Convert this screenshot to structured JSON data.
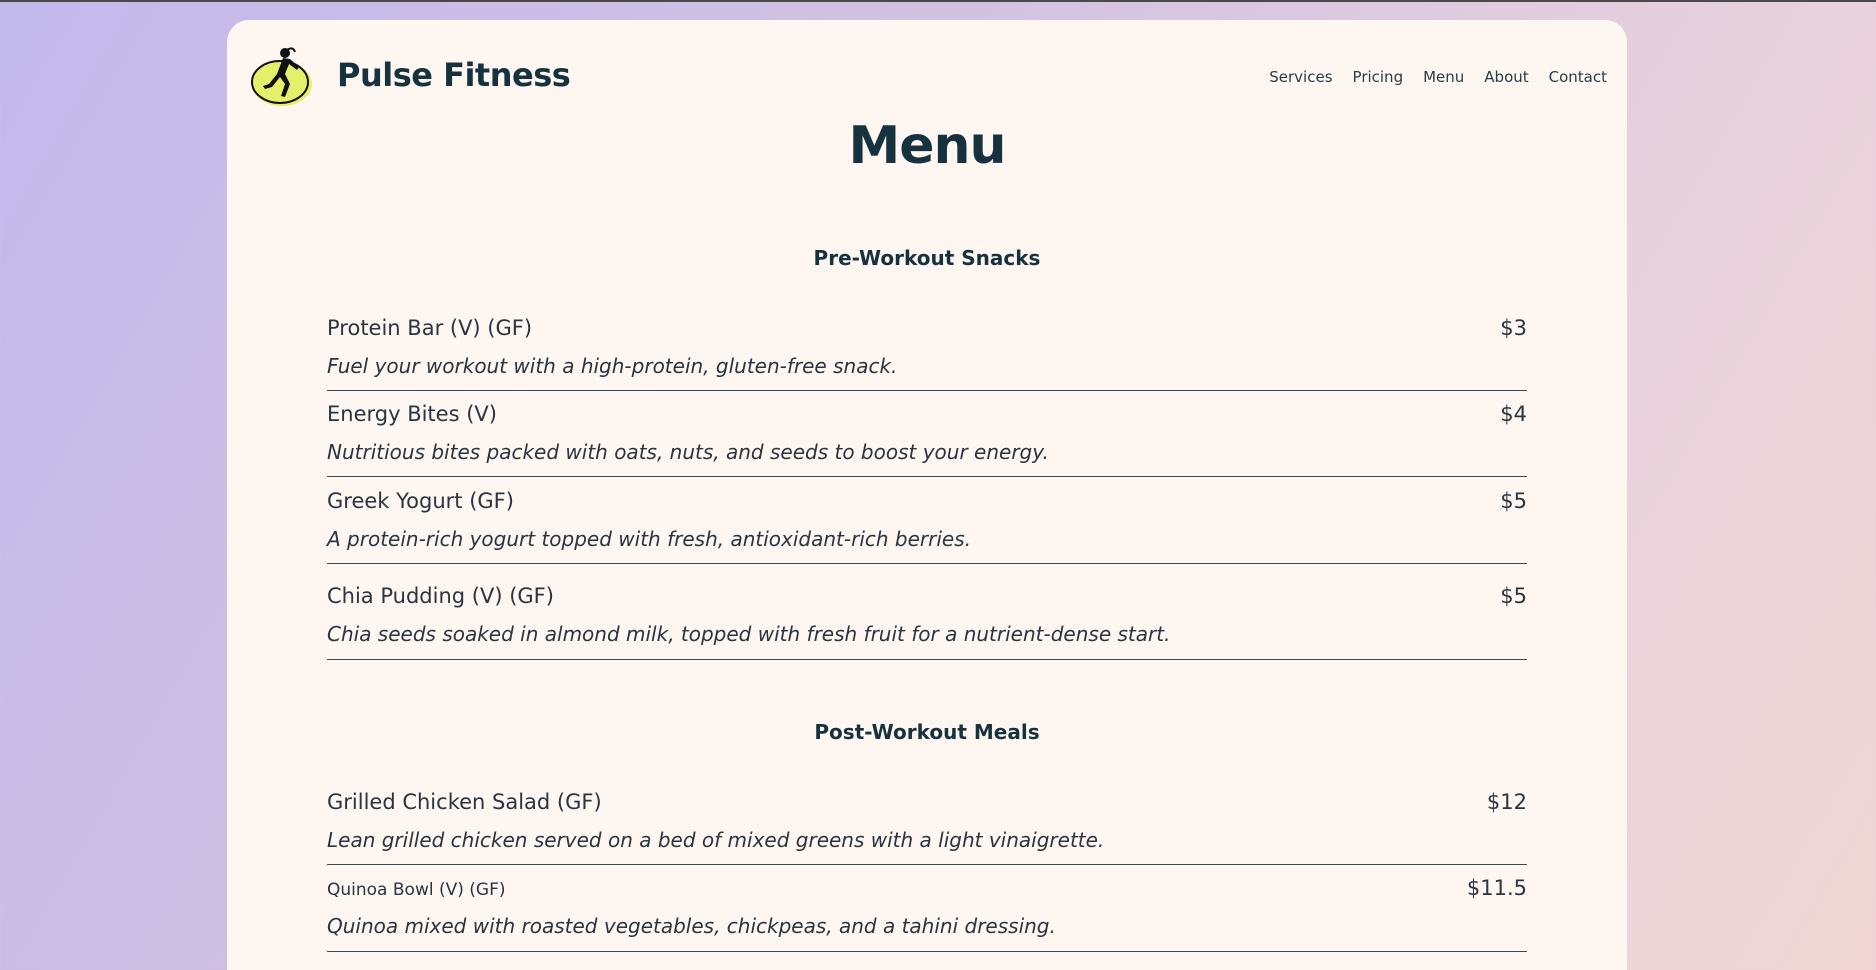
{
  "header": {
    "brand": "Pulse Fitness",
    "logo_icon": "runner-logo-icon",
    "nav": [
      "Services",
      "Pricing",
      "Menu",
      "About",
      "Contact"
    ]
  },
  "page": {
    "title": "Menu"
  },
  "sections": [
    {
      "heading": "Pre-Workout Snacks",
      "items": [
        {
          "name": "Protein Bar (V) (GF)",
          "price": "$3",
          "description": "Fuel your workout with a high-protein, gluten-free snack."
        },
        {
          "name": "Energy Bites (V)",
          "price": "$4",
          "description": "Nutritious bites packed with oats, nuts, and seeds to boost your energy."
        },
        {
          "name": "Greek Yogurt (GF)",
          "price": "$5",
          "description": "A protein-rich yogurt topped with fresh, antioxidant-rich berries."
        },
        {
          "name": "Chia Pudding (V) (GF)",
          "price": "$5",
          "description": "Chia seeds soaked in almond milk, topped with fresh fruit for a nutrient-dense start."
        }
      ]
    },
    {
      "heading": "Post-Workout Meals",
      "items": [
        {
          "name": "Grilled Chicken Salad (GF)",
          "price": "$12",
          "description": "Lean grilled chicken served on a bed of mixed greens with a light vinaigrette."
        },
        {
          "name": "Quinoa Bowl (V) (GF)",
          "price": "$11.5",
          "description": "Quinoa mixed with roasted vegetables, chickpeas, and a tahini dressing."
        }
      ]
    }
  ],
  "colors": {
    "accent_dark": "#17323f",
    "card_bg": "#fdf6f1",
    "logo_accent": "#e4f06a"
  }
}
